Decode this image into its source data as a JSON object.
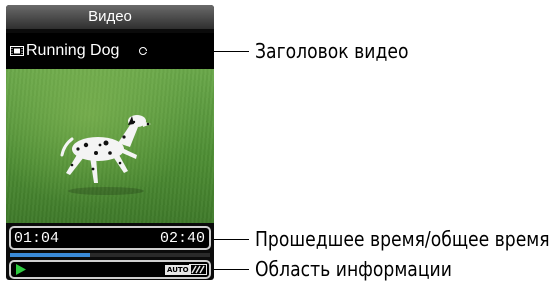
{
  "screen": {
    "header_title": "Видео",
    "video_title": "Running Dog",
    "elapsed_time": "01:04",
    "total_time": "02:40",
    "progress_fraction": 0.4,
    "info": {
      "play_state_icon": "play-icon",
      "auto_badge": "AUTO",
      "battery_icon": "battery-icon"
    }
  },
  "callouts": [
    {
      "label": "Заголовок видео"
    },
    {
      "label": "Прошедшее время/общее время"
    },
    {
      "label": "Область информации"
    }
  ],
  "colors": {
    "progress": "#3a8ad8",
    "play": "#2ecc40",
    "frame_border": "#cfcfcf"
  }
}
